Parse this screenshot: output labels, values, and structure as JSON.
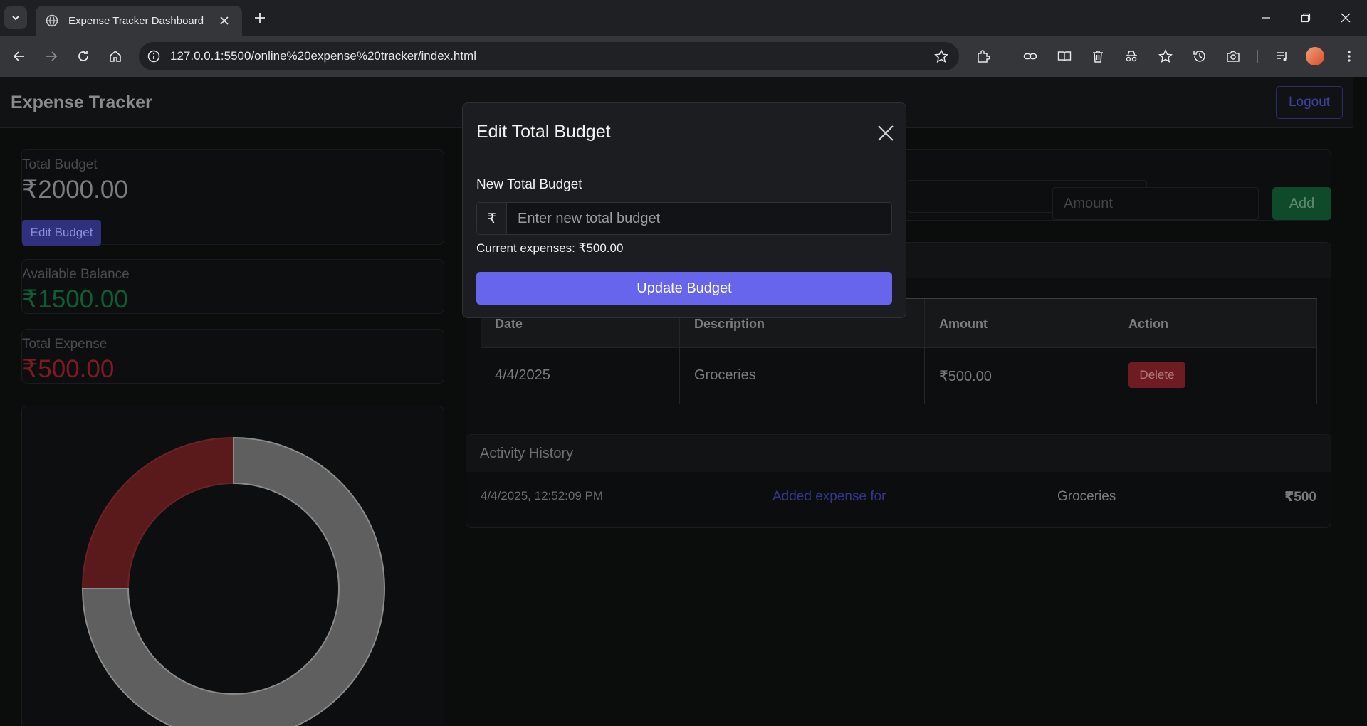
{
  "browser": {
    "tab_title": "Expense Tracker Dashboard",
    "url": "127.0.0.1:5500/online%20expense%20tracker/index.html"
  },
  "app": {
    "title": "Expense Tracker",
    "logout_label": "Logout"
  },
  "summary": {
    "total_budget_label": "Total Budget",
    "total_budget_value": "₹2000.00",
    "edit_budget_label": "Edit Budget",
    "available_balance_label": "Available Balance",
    "available_balance_value": "₹1500.00",
    "total_expense_label": "Total Expense",
    "total_expense_value": "₹500.00"
  },
  "colors": {
    "balance": "#0f5d34",
    "expense": "#7b1c22",
    "accent": "#6665ec",
    "chart_expense": "#5a1a1c",
    "chart_balance": "#5e5f5e"
  },
  "chart_data": {
    "type": "pie",
    "donut": true,
    "labels": [],
    "values": [
      500,
      1500
    ],
    "colors": [
      "#5a1a1c",
      "#5e5f5e"
    ]
  },
  "add_expense": {
    "amount_placeholder": "Amount",
    "add_label": "Add"
  },
  "expenses": {
    "columns": [
      "Date",
      "Description",
      "Amount",
      "Action"
    ],
    "rows": [
      {
        "date": "4/4/2025",
        "description": "Groceries",
        "amount": "₹500.00",
        "action": "Delete"
      }
    ]
  },
  "activity": {
    "title": "Activity History",
    "items": [
      {
        "time": "4/4/2025, 12:52:09 PM",
        "action": "Added expense for",
        "description": "Groceries",
        "amount": "₹500"
      }
    ]
  },
  "modal": {
    "title": "Edit Total Budget",
    "field_label": "New Total Budget",
    "prefix": "₹",
    "placeholder": "Enter new total budget",
    "current_expenses": "Current expenses: ₹500.00",
    "submit_label": "Update Budget"
  }
}
